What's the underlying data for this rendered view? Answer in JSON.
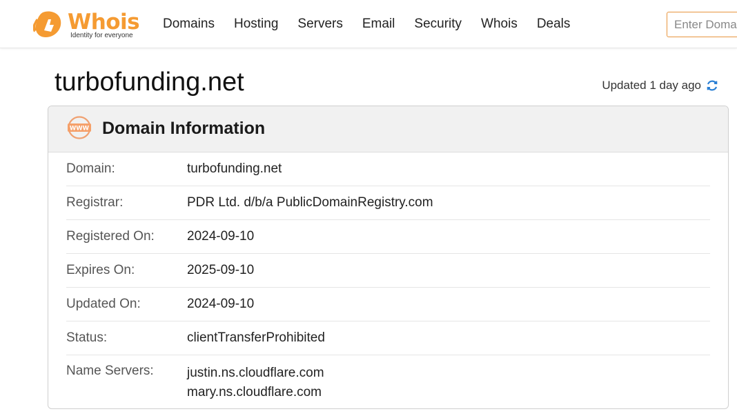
{
  "header": {
    "logo_word": "Whois",
    "logo_tagline": "Identity for everyone",
    "nav": [
      "Domains",
      "Hosting",
      "Servers",
      "Email",
      "Security",
      "Whois",
      "Deals"
    ],
    "search_placeholder": "Enter Domain"
  },
  "page": {
    "domain": "turbofunding.net",
    "updated_text": "Updated 1 day ago"
  },
  "card": {
    "title": "Domain Information",
    "icon_text": "WWW",
    "rows": [
      {
        "label": "Domain:",
        "value": "turbofunding.net"
      },
      {
        "label": "Registrar:",
        "value": "PDR Ltd. d/b/a PublicDomainRegistry.com"
      },
      {
        "label": "Registered On:",
        "value": "2024-09-10"
      },
      {
        "label": "Expires On:",
        "value": "2025-09-10"
      },
      {
        "label": "Updated On:",
        "value": "2024-09-10"
      },
      {
        "label": "Status:",
        "value": "clientTransferProhibited"
      }
    ],
    "name_servers": {
      "label": "Name Servers:",
      "values": [
        "justin.ns.cloudflare.com",
        "mary.ns.cloudflare.com"
      ]
    }
  },
  "colors": {
    "brand_orange": "#f59b32",
    "refresh_blue": "#2a7fd4"
  }
}
